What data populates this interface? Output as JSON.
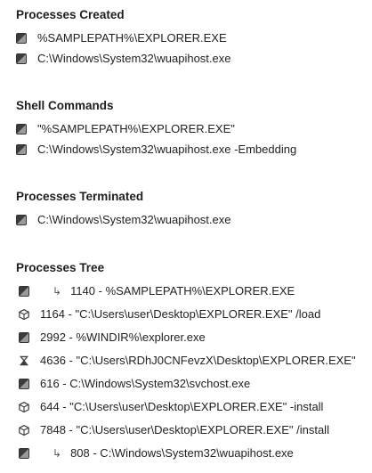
{
  "sections": {
    "created": {
      "title": "Processes Created",
      "items": [
        {
          "icon": "process-icon",
          "text": "%SAMPLEPATH%\\EXPLORER.EXE"
        },
        {
          "icon": "process-icon",
          "text": "C:\\Windows\\System32\\wuapihost.exe"
        }
      ]
    },
    "shell": {
      "title": "Shell Commands",
      "items": [
        {
          "icon": "process-icon",
          "text": "\"%SAMPLEPATH%\\EXPLORER.EXE\""
        },
        {
          "icon": "process-icon",
          "text": "C:\\Windows\\System32\\wuapihost.exe -Embedding"
        }
      ]
    },
    "terminated": {
      "title": "Processes Terminated",
      "items": [
        {
          "icon": "process-icon",
          "text": "C:\\Windows\\System32\\wuapihost.exe"
        }
      ]
    },
    "tree": {
      "title": "Processes Tree",
      "arrow_glyph": "↳",
      "items": [
        {
          "icon": "process-icon",
          "child": true,
          "text": "1140 - %SAMPLEPATH%\\EXPLORER.EXE"
        },
        {
          "icon": "cube-icon",
          "child": false,
          "text": "1164 - \"C:\\Users\\user\\Desktop\\EXPLORER.EXE\" /load"
        },
        {
          "icon": "process-icon",
          "child": false,
          "text": "2992 - %WINDIR%\\explorer.exe"
        },
        {
          "icon": "hourglass-icon",
          "child": false,
          "text": "4636 - \"C:\\Users\\RDhJ0CNFevzX\\Desktop\\EXPLORER.EXE\""
        },
        {
          "icon": "process-icon",
          "child": false,
          "text": "616 - C:\\Windows\\System32\\svchost.exe"
        },
        {
          "icon": "cube-icon",
          "child": false,
          "text": "644 - \"C:\\Users\\user\\Desktop\\EXPLORER.EXE\" -install"
        },
        {
          "icon": "cube-icon",
          "child": false,
          "text": "7848 - \"C:\\Users\\user\\Desktop\\EXPLORER.EXE\" /install"
        },
        {
          "icon": "process-icon",
          "child": true,
          "text": "808 - C:\\Windows\\System32\\wuapihost.exe"
        }
      ]
    }
  },
  "colors": {
    "icon_dark": "#3c3c3c",
    "icon_light": "#e3e3e3",
    "text": "#222222",
    "title": "#1e1e1e"
  }
}
